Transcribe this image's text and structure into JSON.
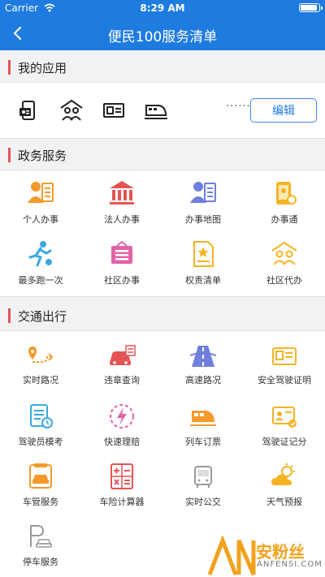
{
  "status_bar": {
    "carrier": "Carrier",
    "time": "8:29 AM",
    "battery_level": 0.9
  },
  "nav": {
    "title": "便民100服务清单"
  },
  "my_apps": {
    "title": "我的应用",
    "icons": [
      "id-card-phone-icon",
      "family-icon",
      "id-card-icon",
      "train-icon"
    ],
    "more_dots": "······",
    "edit_label": "编辑"
  },
  "government": {
    "title": "政务服务",
    "items": [
      {
        "label": "个人办事",
        "icon": "person-doc-icon",
        "color": "#f39a2b"
      },
      {
        "label": "法人办事",
        "icon": "building-icon",
        "color": "#e45454"
      },
      {
        "label": "办事地图",
        "icon": "person-map-icon",
        "color": "#6f7fdc"
      },
      {
        "label": "办事通",
        "icon": "phone-service-icon",
        "color": "#f5b323"
      },
      {
        "label": "最多跑一次",
        "icon": "runner-icon",
        "color": "#3aa8e0"
      },
      {
        "label": "社区办事",
        "icon": "notice-board-icon",
        "color": "#e263a8"
      },
      {
        "label": "权责清单",
        "icon": "star-doc-icon",
        "color": "#f5b323"
      },
      {
        "label": "社区代办",
        "icon": "community-icon",
        "color": "#f5b323"
      }
    ]
  },
  "traffic": {
    "title": "交通出行",
    "items": [
      {
        "label": "实时路况",
        "icon": "route-icon",
        "color": "#f39a2b"
      },
      {
        "label": "违章查询",
        "icon": "car-ticket-icon",
        "color": "#e45454"
      },
      {
        "label": "高速路况",
        "icon": "highway-icon",
        "color": "#6f7fdc"
      },
      {
        "label": "安全驾驶证明",
        "icon": "license-icon",
        "color": "#f5b323"
      },
      {
        "label": "驾驶员模考",
        "icon": "exam-icon",
        "color": "#3aa8e0"
      },
      {
        "label": "快速理赔",
        "icon": "lightning-icon",
        "color": "#e263a8"
      },
      {
        "label": "列车订票",
        "icon": "train-ticket-icon",
        "color": "#f39a2b"
      },
      {
        "label": "驾驶证记分",
        "icon": "license-score-icon",
        "color": "#f5b323"
      },
      {
        "label": "车管服务",
        "icon": "car-service-icon",
        "color": "#f39a2b"
      },
      {
        "label": "车险计算器",
        "icon": "calculator-icon",
        "color": "#e45454"
      },
      {
        "label": "实时公交",
        "icon": "bus-icon",
        "color": "#999999"
      },
      {
        "label": "天气预报",
        "icon": "weather-icon",
        "color": "#f5b323"
      },
      {
        "label": "停车服务",
        "icon": "parking-icon",
        "color": "#999999"
      }
    ]
  },
  "watermark": {
    "brand": "安粉丝",
    "domain": "ANFENSI.COM"
  }
}
